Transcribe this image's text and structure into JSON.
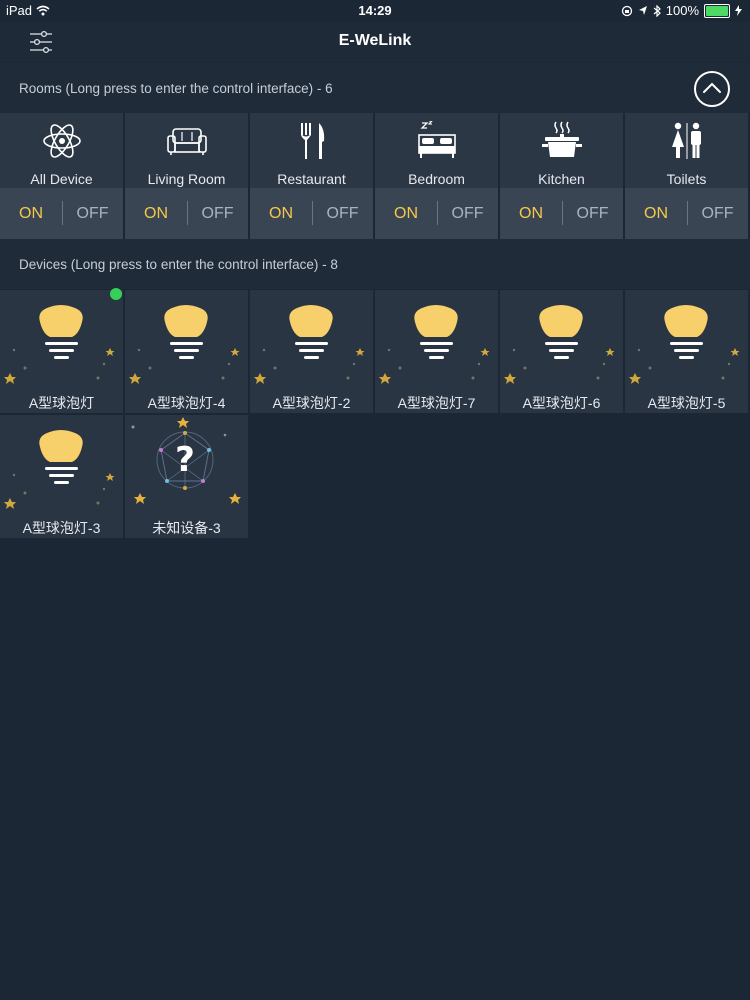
{
  "status_bar": {
    "carrier": "iPad",
    "time": "14:29",
    "battery": "100%",
    "battery_level": 1.0
  },
  "nav": {
    "title": "E-WeLink",
    "menu_icon": "settings-sliders-icon"
  },
  "rooms_section": {
    "label": "Rooms (Long press to enter the control interface) - 6",
    "collapse_icon": "chevron-up-icon"
  },
  "rooms": [
    {
      "name": "All Device",
      "icon": "atom-icon",
      "on": "ON",
      "off": "OFF"
    },
    {
      "name": "Living Room",
      "icon": "sofa-icon",
      "on": "ON",
      "off": "OFF"
    },
    {
      "name": "Restaurant",
      "icon": "fork-knife-icon",
      "on": "ON",
      "off": "OFF"
    },
    {
      "name": "Bedroom",
      "icon": "bed-icon",
      "on": "ON",
      "off": "OFF"
    },
    {
      "name": "Kitchen",
      "icon": "pot-icon",
      "on": "ON",
      "off": "OFF"
    },
    {
      "name": "Toilets",
      "icon": "restroom-icon",
      "on": "ON",
      "off": "OFF"
    }
  ],
  "devices_section": {
    "label": "Devices (Long press to enter the control interface) - 8"
  },
  "devices": [
    {
      "name": "A型球泡灯",
      "type": "bulb",
      "online": true
    },
    {
      "name": "A型球泡灯-4",
      "type": "bulb",
      "online": false
    },
    {
      "name": "A型球泡灯-2",
      "type": "bulb",
      "online": false
    },
    {
      "name": "A型球泡灯-7",
      "type": "bulb",
      "online": false
    },
    {
      "name": "A型球泡灯-6",
      "type": "bulb",
      "online": false
    },
    {
      "name": "A型球泡灯-5",
      "type": "bulb",
      "online": false
    },
    {
      "name": "A型球泡灯-3",
      "type": "bulb",
      "online": false
    },
    {
      "name": "未知设备-3",
      "type": "unknown",
      "online": false
    }
  ],
  "colors": {
    "background": "#1b2735",
    "tile": "#2a3543",
    "on_text": "#f4c84a",
    "bulb": "#f7d06b",
    "online": "#36d058"
  }
}
